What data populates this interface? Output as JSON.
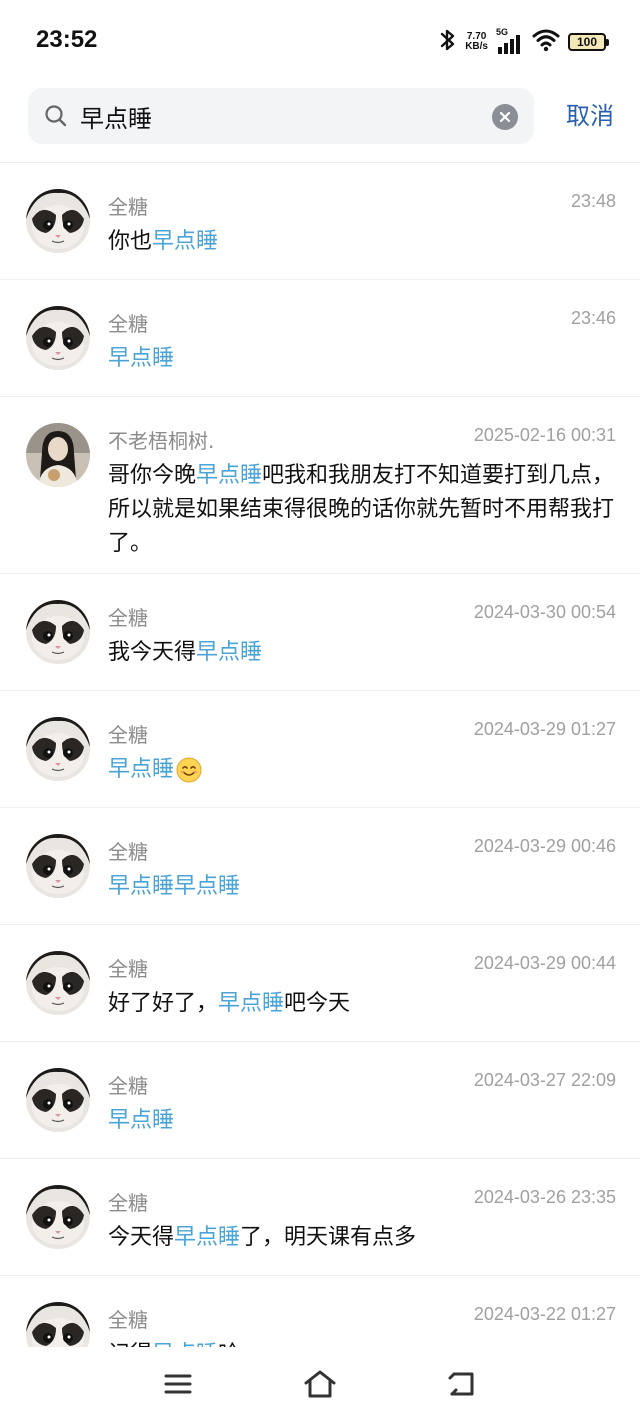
{
  "status_bar": {
    "time": "23:52",
    "net_speed_value": "7.70",
    "net_speed_unit": "KB/s",
    "network_type": "5G",
    "battery": "100",
    "icons": [
      "bluetooth-icon",
      "signal-icon",
      "wifi-icon",
      "battery-icon"
    ]
  },
  "search": {
    "query": "早点睡",
    "placeholder": "",
    "cancel_label": "取消",
    "icons": [
      "search-icon",
      "clear-icon"
    ]
  },
  "results": [
    {
      "sender": "全糖",
      "time": "23:48",
      "avatar": "cat-avatar",
      "parts": [
        {
          "t": "你也",
          "h": false
        },
        {
          "t": "早点睡",
          "h": true
        }
      ]
    },
    {
      "sender": "全糖",
      "time": "23:46",
      "avatar": "cat-avatar",
      "parts": [
        {
          "t": "早点睡",
          "h": true
        }
      ]
    },
    {
      "sender": "不老梧桐树.",
      "time": "2025-02-16 00:31",
      "avatar": "girl-avatar",
      "parts": [
        {
          "t": "哥你今晚",
          "h": false
        },
        {
          "t": "早点睡",
          "h": true
        },
        {
          "t": "吧我和我朋友打不知道要打到几点，所以就是如果结束得很晚的话你就先暂时不用帮我打了。",
          "h": false
        }
      ]
    },
    {
      "sender": "全糖",
      "time": "2024-03-30 00:54",
      "avatar": "cat-avatar",
      "parts": [
        {
          "t": "我今天得",
          "h": false
        },
        {
          "t": "早点睡",
          "h": true
        }
      ]
    },
    {
      "sender": "全糖",
      "time": "2024-03-29 01:27",
      "avatar": "cat-avatar",
      "parts": [
        {
          "t": "早点睡",
          "h": true
        }
      ],
      "emoji": "smile-emoji"
    },
    {
      "sender": "全糖",
      "time": "2024-03-29 00:46",
      "avatar": "cat-avatar",
      "parts": [
        {
          "t": "早点睡早点睡",
          "h": true
        }
      ]
    },
    {
      "sender": "全糖",
      "time": "2024-03-29 00:44",
      "avatar": "cat-avatar",
      "parts": [
        {
          "t": "好了好了，",
          "h": false
        },
        {
          "t": "早点睡",
          "h": true
        },
        {
          "t": "吧今天",
          "h": false
        }
      ]
    },
    {
      "sender": "全糖",
      "time": "2024-03-27 22:09",
      "avatar": "cat-avatar",
      "parts": [
        {
          "t": "早点睡",
          "h": true
        }
      ]
    },
    {
      "sender": "全糖",
      "time": "2024-03-26 23:35",
      "avatar": "cat-avatar",
      "parts": [
        {
          "t": "今天得",
          "h": false
        },
        {
          "t": "早点睡",
          "h": true
        },
        {
          "t": "了，明天课有点多",
          "h": false
        }
      ]
    },
    {
      "sender": "全糖",
      "time": "2024-03-22 01:27",
      "avatar": "cat-avatar",
      "parts": [
        {
          "t": "记得",
          "h": false
        },
        {
          "t": "早点睡",
          "h": true
        },
        {
          "t": "哈",
          "h": false
        }
      ]
    }
  ],
  "nav_bar": {
    "icons": [
      "menu-icon",
      "home-icon",
      "back-icon"
    ]
  }
}
